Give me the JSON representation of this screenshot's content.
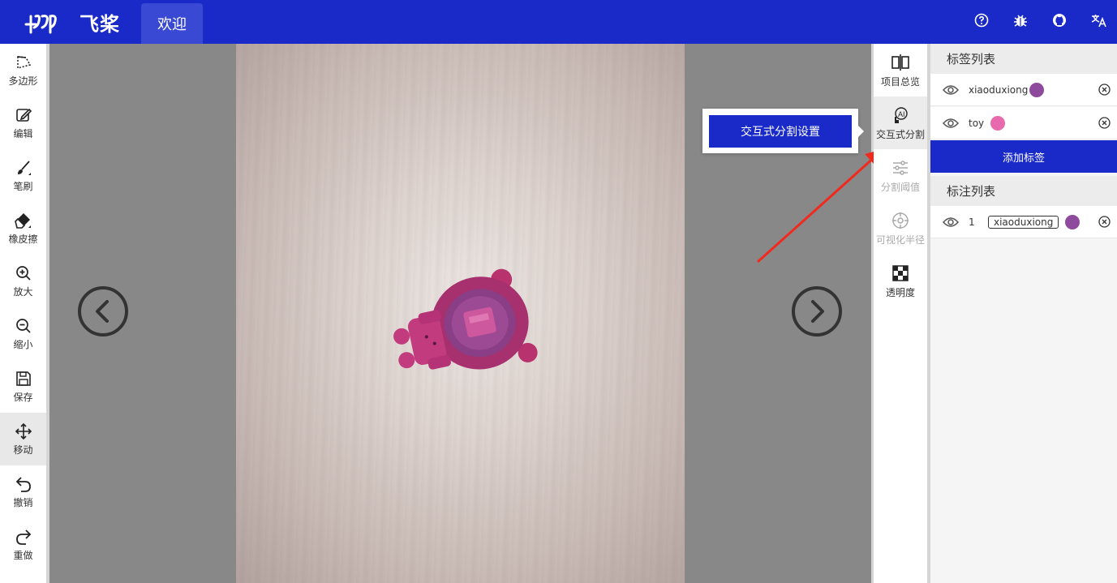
{
  "header": {
    "brand": "飞桨",
    "tab_welcome": "欢迎",
    "icons": [
      "help-icon",
      "bug-icon",
      "github-icon",
      "translate-icon"
    ]
  },
  "left_tools": [
    {
      "label": "多边形",
      "icon": "polygon-icon"
    },
    {
      "label": "编辑",
      "icon": "edit-icon"
    },
    {
      "label": "笔刷",
      "icon": "brush-icon"
    },
    {
      "label": "橡皮擦",
      "icon": "eraser-icon"
    },
    {
      "label": "放大",
      "icon": "zoom-in-icon"
    },
    {
      "label": "缩小",
      "icon": "zoom-out-icon"
    },
    {
      "label": "保存",
      "icon": "save-icon"
    },
    {
      "label": "移动",
      "icon": "move-icon",
      "active": true
    },
    {
      "label": "撤销",
      "icon": "undo-icon"
    },
    {
      "label": "重做",
      "icon": "redo-icon"
    }
  ],
  "right_tools": [
    {
      "label": "项目总览",
      "icon": "overview-icon"
    },
    {
      "label": "交互式分割",
      "icon": "ai-segment-icon",
      "active": true
    },
    {
      "label": "分割阈值",
      "icon": "threshold-icon",
      "disabled": true
    },
    {
      "label": "可视化半径",
      "icon": "radius-icon",
      "disabled": true
    },
    {
      "label": "透明度",
      "icon": "opacity-icon"
    }
  ],
  "popover": {
    "button_label": "交互式分割设置"
  },
  "label_panel": {
    "title": "标签列表",
    "labels": [
      {
        "name": "xiaoduxiong",
        "color": "#8e4a9c"
      },
      {
        "name": "toy",
        "color": "#e86aae"
      }
    ],
    "add_button": "添加标签"
  },
  "annotation_panel": {
    "title": "标注列表",
    "items": [
      {
        "index": "1",
        "label": "xiaoduxiong",
        "color": "#8e4a9c"
      }
    ]
  },
  "colors": {
    "primary": "#1a2ac8",
    "canvas_bg": "#888888"
  }
}
